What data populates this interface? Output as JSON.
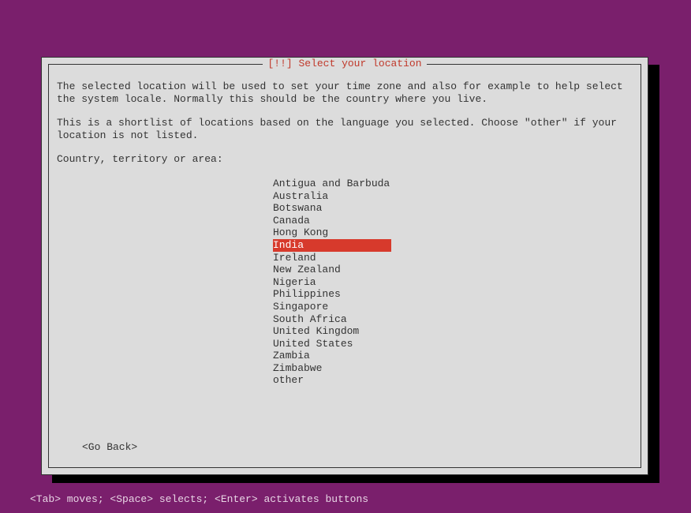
{
  "title": "[!!] Select your location",
  "paragraph1": "The selected location will be used to set your time zone and also for example to help select the system locale. Normally this should be the country where you live.",
  "paragraph2": "This is a shortlist of locations based on the language you selected. Choose \"other\" if your location is not listed.",
  "prompt": "Country, territory or area:",
  "locations": [
    "Antigua and Barbuda",
    "Australia",
    "Botswana",
    "Canada",
    "Hong Kong",
    "India",
    "Ireland",
    "New Zealand",
    "Nigeria",
    "Philippines",
    "Singapore",
    "South Africa",
    "United Kingdom",
    "United States",
    "Zambia",
    "Zimbabwe",
    "other"
  ],
  "selected_index": 5,
  "go_back": "<Go Back>",
  "footer": "<Tab> moves; <Space> selects; <Enter> activates buttons"
}
